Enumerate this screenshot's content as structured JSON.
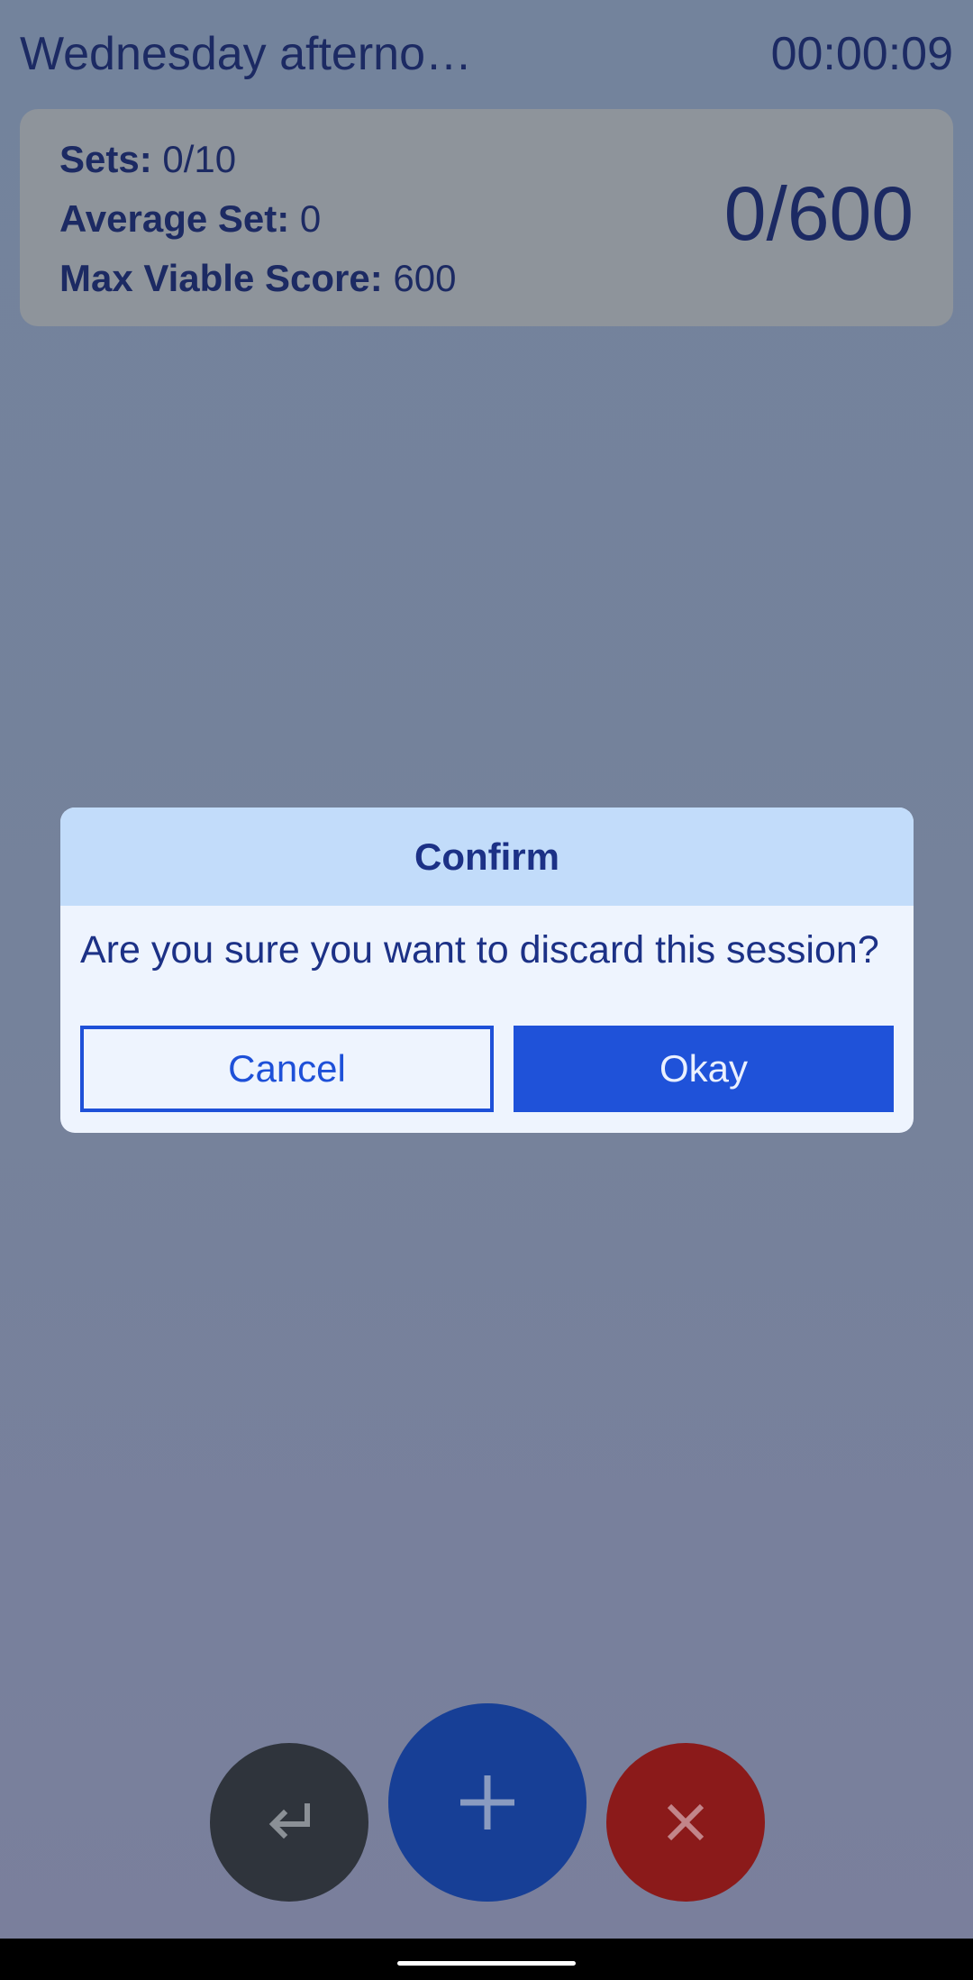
{
  "header": {
    "title": "Wednesday afterno…",
    "timer": "00:00:09"
  },
  "stats": {
    "sets_label": "Sets:",
    "sets_value": "0/10",
    "average_label": "Average Set:",
    "average_value": "0",
    "max_label": "Max Viable Score:",
    "max_value": "600",
    "score": "0/600"
  },
  "dialog": {
    "title": "Confirm",
    "message": "Are you sure you want to discard this session?",
    "cancel_label": "Cancel",
    "okay_label": "Okay"
  },
  "fabs": {
    "back_icon": "return-icon",
    "add_icon": "plus-icon",
    "close_icon": "close-icon"
  },
  "colors": {
    "primary_text": "#1c2a63",
    "accent_blue": "#1f52d9",
    "danger_red": "#8b1a1a",
    "dialog_header": "#c2dcfa"
  }
}
